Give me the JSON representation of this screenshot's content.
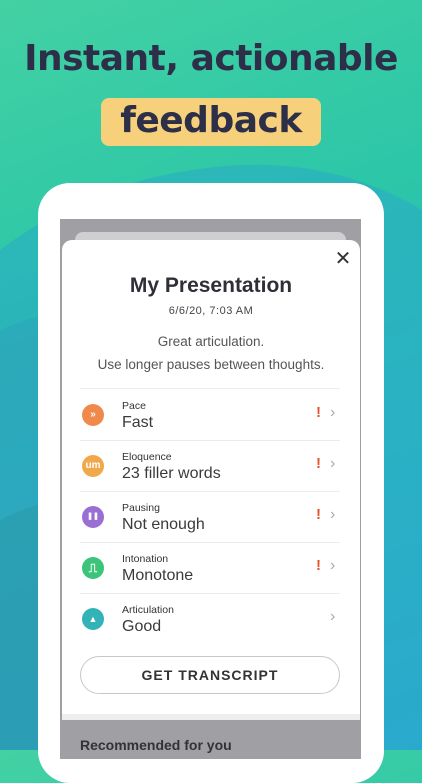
{
  "hero": {
    "headline": "Instant, actionable",
    "badge": "feedback"
  },
  "report": {
    "close_icon": "close-icon",
    "title": "My Presentation",
    "datetime": "6/6/20, 7:03 AM",
    "summary_line1": "Great articulation.",
    "summary_line2": "Use longer pauses between thoughts.",
    "metrics": [
      {
        "label": "Pace",
        "value": "Fast",
        "icon": "pace-icon",
        "icon_glyph": "»",
        "color": "#f08a4b",
        "warning": "!"
      },
      {
        "label": "Eloquence",
        "value": "23 filler words",
        "icon": "eloquence-icon",
        "icon_glyph": "um",
        "color": "#f0a84b",
        "warning": "!"
      },
      {
        "label": "Pausing",
        "value": "Not enough",
        "icon": "pausing-icon",
        "icon_glyph": "❚❚",
        "color": "#9a6fd3",
        "warning": "!"
      },
      {
        "label": "Intonation",
        "value": "Monotone",
        "icon": "intonation-icon",
        "icon_glyph": "⎍",
        "color": "#3cc47a",
        "warning": "!"
      },
      {
        "label": "Articulation",
        "value": "Good",
        "icon": "articulation-icon",
        "icon_glyph": "▲",
        "color": "#33b3b8",
        "warning": ""
      }
    ],
    "transcript_button": "GET TRANSCRIPT",
    "recommended_heading": "Recommended for you"
  }
}
